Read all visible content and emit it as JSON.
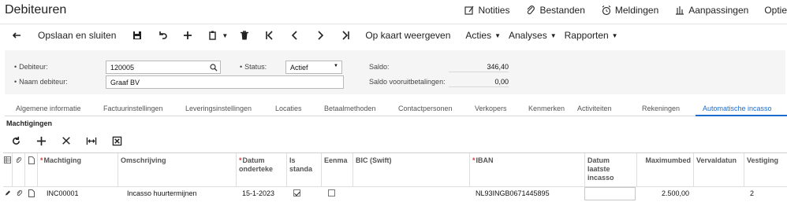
{
  "window": {
    "title": "Debiteuren",
    "links": [
      {
        "label": "Notities",
        "icon": "note-icon"
      },
      {
        "label": "Bestanden",
        "icon": "paperclip-icon"
      },
      {
        "label": "Meldingen",
        "icon": "alarm-icon"
      },
      {
        "label": "Aanpassingen",
        "icon": "customize-icon"
      },
      {
        "label": "Optie",
        "icon": ""
      }
    ]
  },
  "toolbar": {
    "save_close": "Opslaan en sluiten",
    "map_view": "Op kaart weergeven",
    "actions": "Acties",
    "analyses": "Analyses",
    "reports": "Rapporten"
  },
  "form": {
    "debtor_label": "Debiteur:",
    "debtor_value": "120005",
    "name_label": "Naam debiteur:",
    "name_value": "Graaf BV",
    "status_label": "Status:",
    "status_value": "Actief",
    "balance_label": "Saldo:",
    "balance_value": "346,40",
    "prepay_label": "Saldo vooruitbetalingen:",
    "prepay_value": "0,00"
  },
  "tabs": [
    "Algemene informatie",
    "Factuurinstellingen",
    "Leveringsinstellingen",
    "Locaties",
    "Betaalmethoden",
    "Contactpersonen",
    "Verkopers",
    "Kenmerken",
    "Activiteiten",
    "Rekeningen",
    "Automatische incasso"
  ],
  "active_tab": "Automatische incasso",
  "section": {
    "title": "Machtigingen"
  },
  "grid": {
    "headers": {
      "mandate": "Machtiging",
      "description": "Omschrijving",
      "date_signed": "Datum onderteke",
      "is_default": "Is standa",
      "one_off": "Eenma",
      "bic": "BIC (Swift)",
      "iban": "IBAN",
      "last_collection": "Datum laatste incasso",
      "max_amount": "Maximumbed",
      "expiry": "Vervaldatun",
      "branch": "Vestiging"
    },
    "rows": [
      {
        "mandate": "INC00001",
        "description": "Incasso huurtermijnen",
        "date_signed": "15-1-2023",
        "is_default": true,
        "one_off": false,
        "bic": "",
        "iban": "NL93INGB0671445895",
        "last_collection": "",
        "max_amount": "2.500,00",
        "expiry": "",
        "branch": "2"
      }
    ]
  },
  "colors": {
    "accent": "#1a6ccf",
    "required": "#d03a3a"
  }
}
